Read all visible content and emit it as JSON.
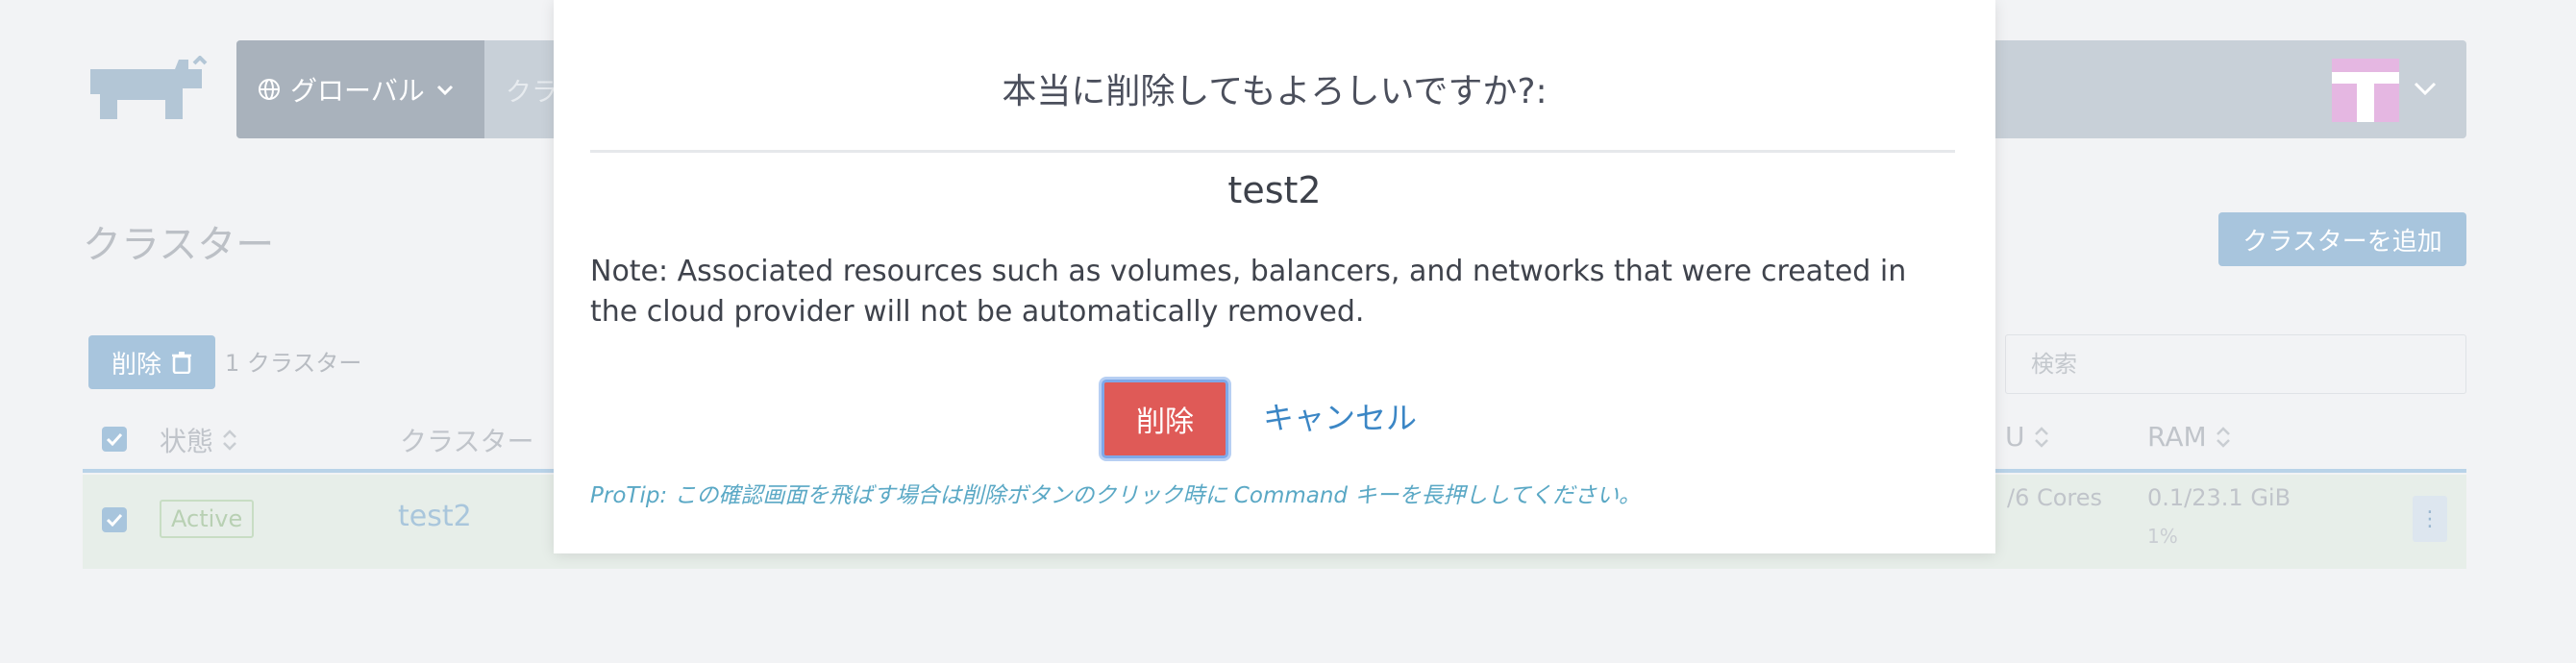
{
  "header": {
    "scope_label": "グローバル",
    "crumb_label": "クラ"
  },
  "page": {
    "title": "クラスター",
    "add_cluster_label": "クラスターを追加"
  },
  "toolbar": {
    "bulk_delete_label": "削除",
    "cluster_count": "1 クラスター",
    "search_placeholder": "検索"
  },
  "table": {
    "columns": {
      "state": "状態",
      "name": "クラスター",
      "cpu": "U",
      "ram": "RAM"
    },
    "rows": [
      {
        "state": "Active",
        "name": "test2",
        "cpu": "/6 Cores",
        "ram": "0.1/23.1 GiB",
        "ram_pct": "1%",
        "actions": "⋮"
      }
    ]
  },
  "modal": {
    "title": "本当に削除してもよろしいですか?:",
    "target": "test2",
    "note": "Note: Associated resources such as volumes, balancers, and networks that were created in the cloud provider will not be automatically removed.",
    "delete_label": "削除",
    "cancel_label": "キャンセル",
    "protip": "ProTip: この確認画面を飛ばす場合は削除ボタンのクリック時に Command キーを長押ししてください。"
  },
  "colors": {
    "danger": "#df5a57",
    "link": "#3b86c5",
    "protip": "#5aa8c5"
  }
}
